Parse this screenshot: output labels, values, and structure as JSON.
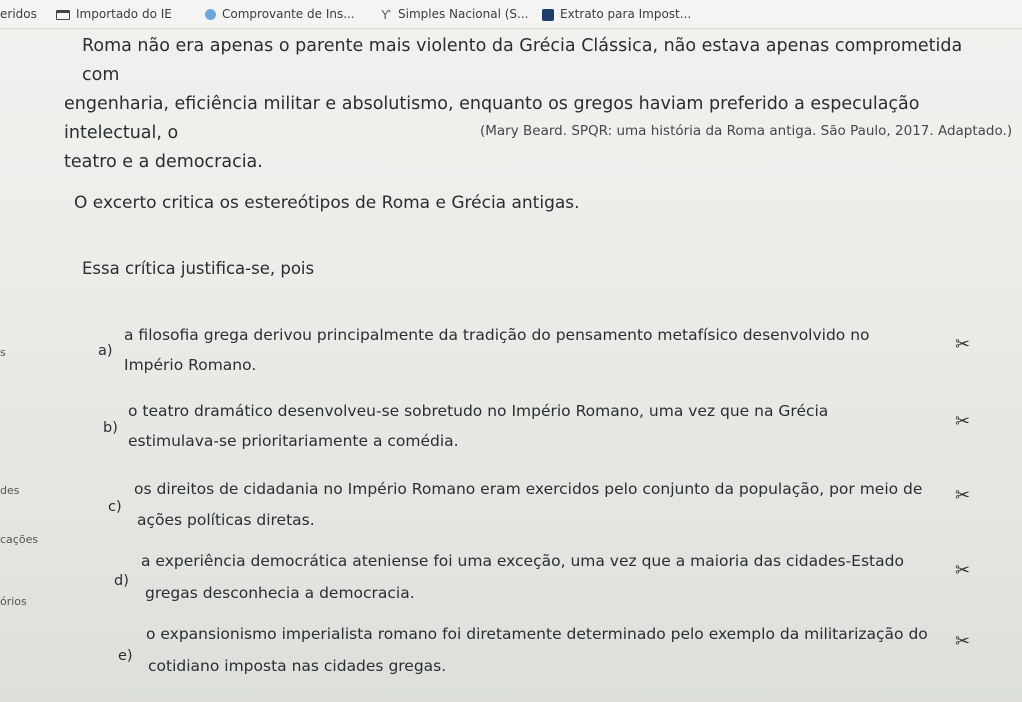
{
  "bookmarks_bar": {
    "items": [
      {
        "label": "eridos",
        "icon": "none"
      },
      {
        "label": "Importado do IE",
        "icon": "folder-icon"
      },
      {
        "label": "Comprovante de Ins...",
        "icon": "globe-icon"
      },
      {
        "label": "Simples Nacional (S...",
        "icon": "fork-icon"
      },
      {
        "label": "Extrato para Impost...",
        "icon": "bookmark-icon"
      }
    ]
  },
  "side_fragments": {
    "s1": "s",
    "s2": "des",
    "s3": "cações",
    "s4": "órios"
  },
  "passage": {
    "line1": "Roma não era apenas o parente mais violento da Grécia Clássica, não estava apenas comprometida com",
    "line2": "engenharia, eficiência militar e absolutismo, enquanto os gregos haviam preferido a especulação intelectual, o",
    "line3": "teatro e a democracia.",
    "source": "(Mary Beard. SPQR: uma história da Roma antiga. São Paulo, 2017. Adaptado.)"
  },
  "question": "O excerto critica os estereótipos de Roma e Grécia antigas.",
  "prompt": "Essa crítica justifica-se, pois",
  "options": [
    {
      "letter": "a)",
      "line1": "a filosofia grega derivou principalmente da tradição do pensamento metafísico desenvolvido no",
      "line2": "Império Romano."
    },
    {
      "letter": "b)",
      "line1": "o teatro dramático desenvolveu-se sobretudo no Império Romano, uma vez que na Grécia",
      "line2": "estimulava-se prioritariamente a comédia."
    },
    {
      "letter": "c)",
      "line1": "os direitos de cidadania no Império Romano eram exercidos pelo conjunto da população, por meio de",
      "line2": "ações políticas diretas."
    },
    {
      "letter": "d)",
      "line1": "a experiência democrática ateniense foi uma exceção, uma vez que a maioria das cidades-Estado",
      "line2": "gregas desconhecia a democracia."
    },
    {
      "letter": "e)",
      "line1": "o expansionismo imperialista romano foi diretamente determinado pelo exemplo da militarização do",
      "line2": "cotidiano imposta nas cidades gregas."
    }
  ],
  "scissors_glyph": "✂"
}
